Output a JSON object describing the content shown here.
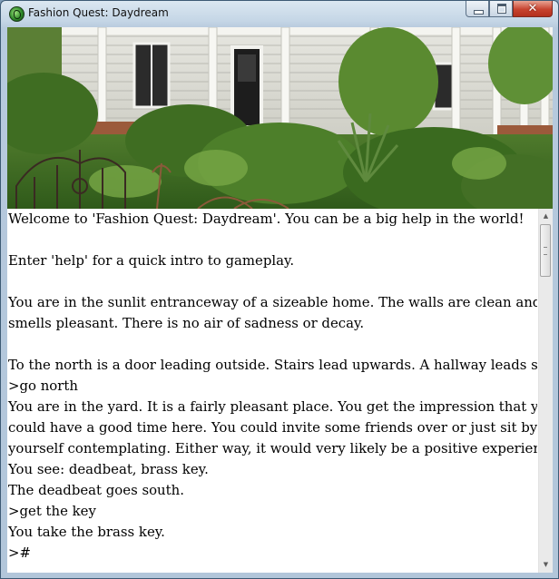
{
  "window": {
    "title": "Fashion Quest: Daydream",
    "icon": "game-globe-icon",
    "controls": {
      "minimize": "−",
      "maximize": "□",
      "close": "✕"
    }
  },
  "banner": {
    "description_icon": "house-porch-garden-image"
  },
  "transcript": {
    "lines": [
      "Welcome to 'Fashion Quest: Daydream'. You can be a big help in the world!",
      "",
      "Enter 'help' for a quick intro to gameplay.",
      "",
      "You are in the sunlit entranceway of a sizeable home. The walls are clean and it",
      "smells pleasant. There is no air of sadness or decay.",
      "",
      "To the north is a door leading outside. Stairs lead upwards. A hallway leads south.",
      ">go north",
      "You are in the yard. It is a fairly pleasant place. You get the impression that you",
      "could have a good time here. You could invite some friends over or just sit by",
      "yourself contemplating. Either way, it would very likely be a positive experience.",
      "You see: deadbeat, brass key.",
      "The deadbeat goes south.",
      ">get the key",
      "You take the brass key.",
      ">#"
    ]
  },
  "scrollbar": {
    "up_arrow": "▲",
    "down_arrow": "▼"
  }
}
